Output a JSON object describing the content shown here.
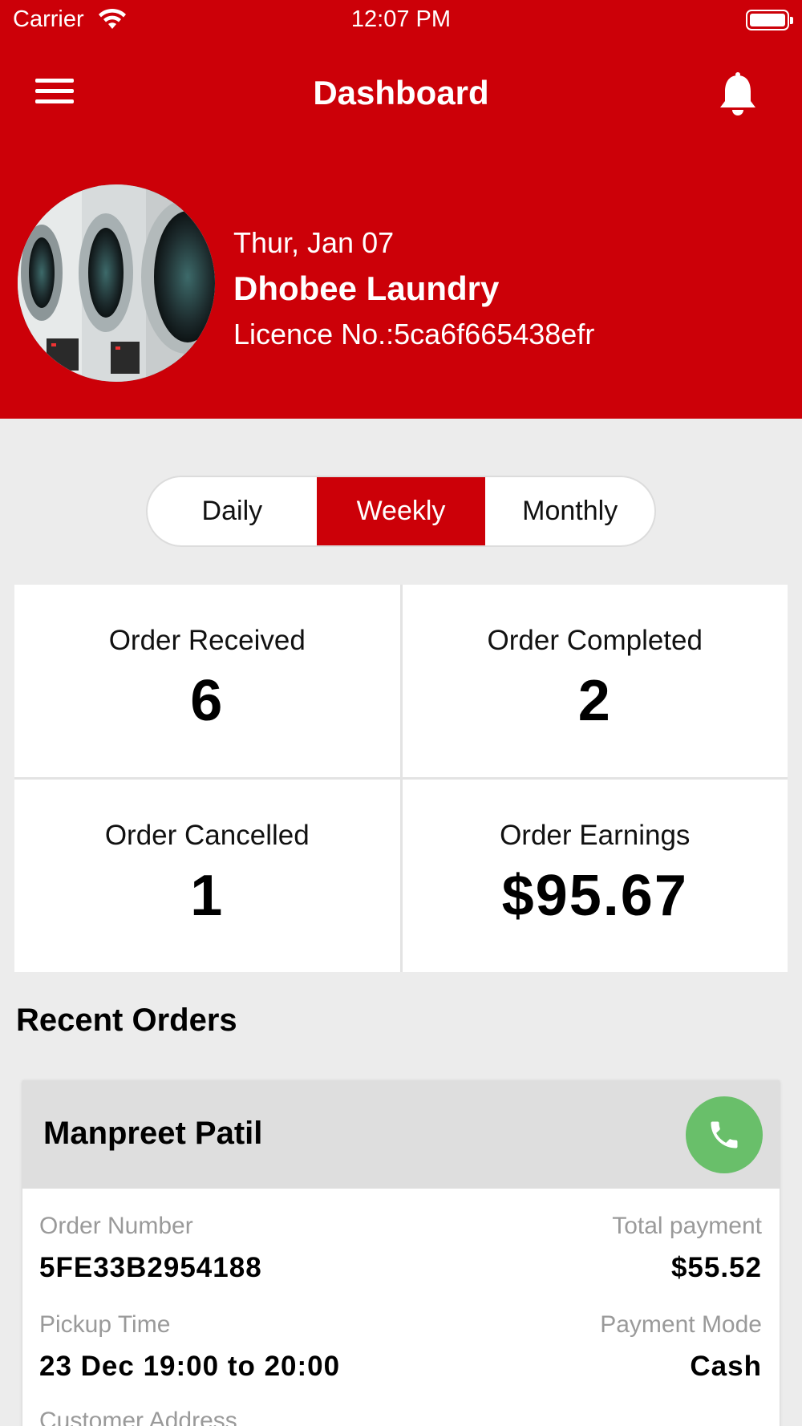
{
  "status_bar": {
    "carrier": "Carrier",
    "time": "12:07 PM"
  },
  "navbar": {
    "title": "Dashboard",
    "menu_icon": "hamburger-menu-icon",
    "bell_icon": "bell-icon"
  },
  "profile": {
    "date": "Thur, Jan 07",
    "name": "Dhobee Laundry",
    "licence": "Licence No.:5ca6f665438efr"
  },
  "period_tabs": {
    "items": [
      "Daily",
      "Weekly",
      "Monthly"
    ],
    "selected": "Weekly"
  },
  "stats": [
    {
      "label": "Order Received",
      "value": "6"
    },
    {
      "label": "Order Completed",
      "value": "2"
    },
    {
      "label": "Order Cancelled",
      "value": "1"
    },
    {
      "label": "Order Earnings",
      "value": "$95.67"
    }
  ],
  "recent_orders": {
    "title": "Recent Orders",
    "items": [
      {
        "customer": "Manpreet Patil",
        "order_number_label": "Order Number",
        "order_number": "5FE33B2954188",
        "total_payment_label": "Total payment",
        "total_payment": "$55.52",
        "pickup_time_label": "Pickup Time",
        "pickup_time": "23 Dec 19:00 to 20:00",
        "payment_mode_label": "Payment Mode",
        "payment_mode": "Cash",
        "address_label": "Customer Address"
      }
    ]
  },
  "colors": {
    "primary": "#cc0008",
    "call_green": "#69bf6a",
    "background": "#ececec"
  }
}
